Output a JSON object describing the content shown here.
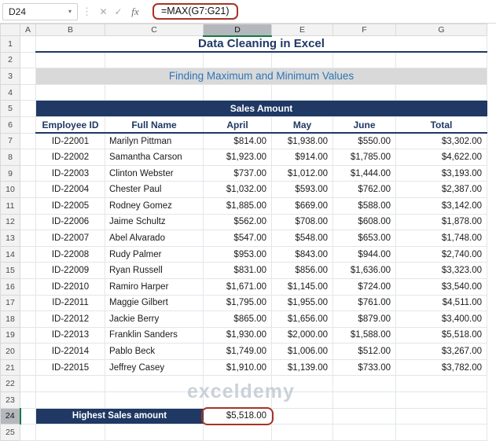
{
  "formula_bar": {
    "name_box": "D24",
    "formula": "=MAX(G7:G21)"
  },
  "icons": {
    "dropdown": "▾",
    "separator": "⋮",
    "cancel": "✕",
    "enter": "✓",
    "fx": "fx"
  },
  "sheet": {
    "columns": [
      "A",
      "B",
      "C",
      "D",
      "E",
      "F",
      "G"
    ],
    "selected_column": "D",
    "selected_row": 24,
    "row_count": 25
  },
  "title": {
    "text": "Data Cleaning in Excel"
  },
  "subtitle": {
    "text": "Finding Maximum and Minimum Values"
  },
  "table": {
    "band_title": "Sales Amount",
    "headers": [
      "Employee ID",
      "Full Name",
      "April",
      "May",
      "June",
      "Total"
    ],
    "rows": [
      [
        "ID-22001",
        "Marilyn Pittman",
        "$814.00",
        "$1,938.00",
        "$550.00",
        "$3,302.00"
      ],
      [
        "ID-22002",
        "Samantha Carson",
        "$1,923.00",
        "$914.00",
        "$1,785.00",
        "$4,622.00"
      ],
      [
        "ID-22003",
        "Clinton Webster",
        "$737.00",
        "$1,012.00",
        "$1,444.00",
        "$3,193.00"
      ],
      [
        "ID-22004",
        "Chester Paul",
        "$1,032.00",
        "$593.00",
        "$762.00",
        "$2,387.00"
      ],
      [
        "ID-22005",
        "Rodney Gomez",
        "$1,885.00",
        "$669.00",
        "$588.00",
        "$3,142.00"
      ],
      [
        "ID-22006",
        "Jaime Schultz",
        "$562.00",
        "$708.00",
        "$608.00",
        "$1,878.00"
      ],
      [
        "ID-22007",
        "Abel Alvarado",
        "$547.00",
        "$548.00",
        "$653.00",
        "$1,748.00"
      ],
      [
        "ID-22008",
        "Rudy Palmer",
        "$953.00",
        "$843.00",
        "$944.00",
        "$2,740.00"
      ],
      [
        "ID-22009",
        "Ryan Russell",
        "$831.00",
        "$856.00",
        "$1,636.00",
        "$3,323.00"
      ],
      [
        "ID-22010",
        "Ramiro Harper",
        "$1,671.00",
        "$1,145.00",
        "$724.00",
        "$3,540.00"
      ],
      [
        "ID-22011",
        "Maggie Gilbert",
        "$1,795.00",
        "$1,955.00",
        "$761.00",
        "$4,511.00"
      ],
      [
        "ID-22012",
        "Jackie Berry",
        "$865.00",
        "$1,656.00",
        "$879.00",
        "$3,400.00"
      ],
      [
        "ID-22013",
        "Franklin Sanders",
        "$1,930.00",
        "$2,000.00",
        "$1,588.00",
        "$5,518.00"
      ],
      [
        "ID-22014",
        "Pablo Beck",
        "$1,749.00",
        "$1,006.00",
        "$512.00",
        "$3,267.00"
      ],
      [
        "ID-22015",
        "Jeffrey Casey",
        "$1,910.00",
        "$1,139.00",
        "$733.00",
        "$3,782.00"
      ]
    ]
  },
  "summary": {
    "label": "Highest Sales amount",
    "value": "$5,518.00"
  },
  "watermark": {
    "brand": "exceldemy"
  },
  "colors": {
    "navy": "#1F3864",
    "subtitle_blue": "#2E75B6",
    "band_gray": "#D9D9D9",
    "annotation_red": "#A93226",
    "selection_green": "#107C41"
  }
}
